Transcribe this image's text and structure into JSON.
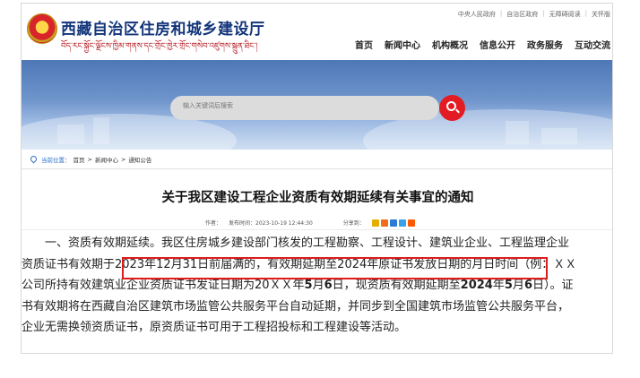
{
  "top_links": [
    "中央人民政府",
    "自治区政府",
    "无障碍阅读",
    "关怀版"
  ],
  "header": {
    "title": "西藏自治区住房和城乡建设厅",
    "subtitle_tibetan": "བོད་རང་སྐྱོང་ལྗོངས་ཁྱིམ་གནས་དང་གྲོང་ཁྱེར་གྲོང་གསེབ་འཛུགས་སྐྲུན་ཐིང་།"
  },
  "nav": [
    "首页",
    "新闻中心",
    "机构概况",
    "信息公开",
    "政务服务",
    "互动交流"
  ],
  "search": {
    "placeholder": "输入关键词后搜索"
  },
  "breadcrumb": {
    "label": "当前位置：",
    "items": [
      "首页",
      "新闻中心",
      "通知公告"
    ],
    "separator": ">"
  },
  "article": {
    "title": "关于我区建设工程企业资质有效期延续有关事宜的通知",
    "author_label": "作者：",
    "published_label": "发布时间：",
    "published_value": "2023-10-19 12:44:30",
    "share_label": "分享到：",
    "share_colors": [
      "#e3b000",
      "#f26a1b",
      "#2a7bd4",
      "#3aa0e8",
      "#ff5a00"
    ],
    "lines": {
      "l1": "一、资质有效期延续。我区住房城乡建设部门核发的工程勘察、工程设计、建筑业企业、工程监理企业",
      "l2a": "资质证书有效期于",
      "l2b": "2023年12月31日前届满的，有效期延期至2024年原证书发放日期的月日时间",
      "l2c": "（例：ＸＸ",
      "l3a": "公司所持有效建筑业企业资质证书发证日期为20ＸＸ年",
      "l3b": "5",
      "l3c": "月",
      "l3d": "6",
      "l3e": "日，现资质有效期延期至",
      "l3f": "2024",
      "l3g": "年",
      "l3h": "5",
      "l3i": "月",
      "l3j": "6",
      "l3k": "日）。证",
      "l4": "书有效期将在西藏自治区建筑市场监管公共服务平台自动延期，并同步到全国建筑市场监管公共服务平台，",
      "l5": "企业无需换领资质证书，原资质证书可用于工程招投标和工程建设等活动。"
    }
  }
}
